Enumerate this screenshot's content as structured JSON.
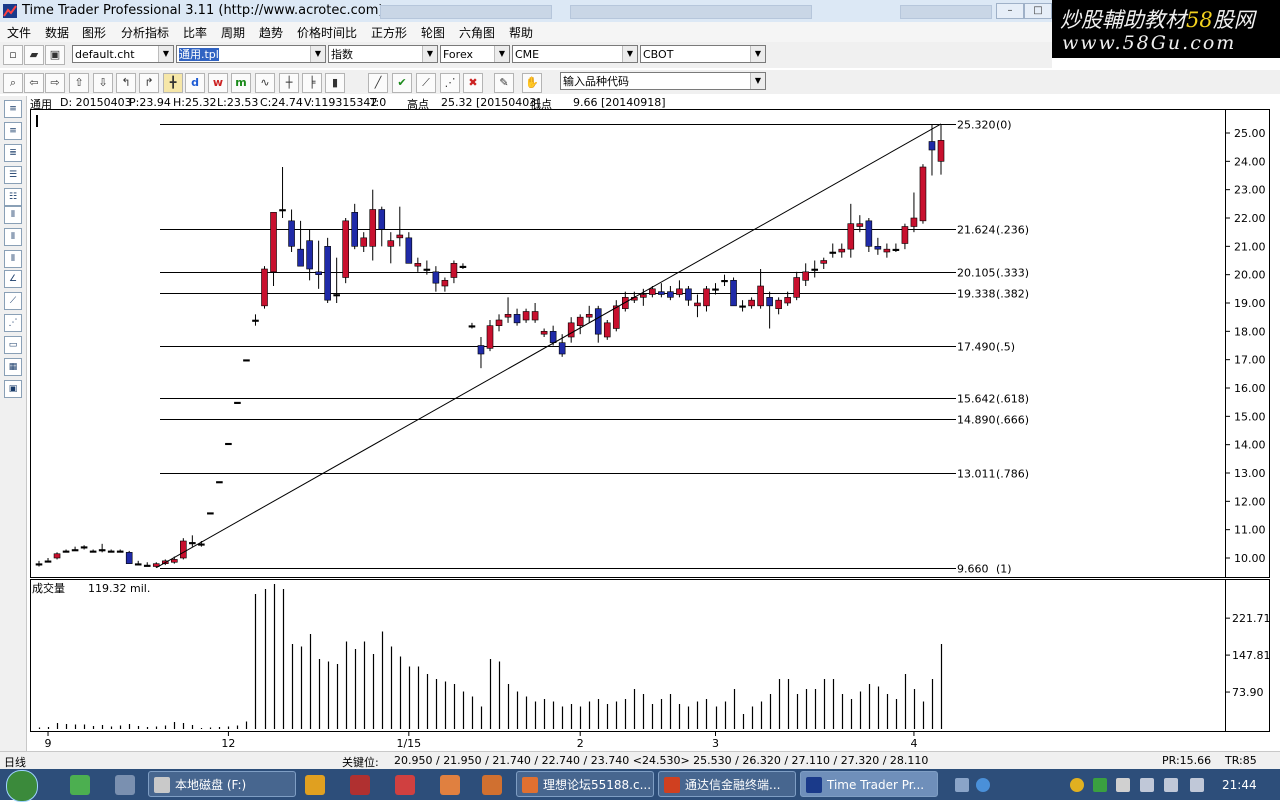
{
  "window": {
    "app_name": "Time Trader Professional 3.11",
    "url": "(http://www.acrotec.com)"
  },
  "watermark": {
    "line1_prefix": "炒股輔助教材",
    "line1_num": "58",
    "line1_suffix": "股网",
    "line2": "www.58Gu.com"
  },
  "menu": [
    "文件",
    "数据",
    "图形",
    "分析指标",
    "比率",
    "周期",
    "趋势",
    "价格时间比",
    "正方形",
    "轮图",
    "六角图",
    "帮助"
  ],
  "toolbar": {
    "chart_file": "default.cht",
    "template": "通用.tpl",
    "index": "指数",
    "market1": "Forex",
    "market2": "CME",
    "market3": "CBOT",
    "symbol_input": "输入品种代码"
  },
  "info": {
    "name": "通用",
    "date": "D: 20150403",
    "p": "P:23.94",
    "h": "H:25.32",
    "l": "L:23.53",
    "c": "C:24.74",
    "v": "V:119315342",
    "t": "T:0",
    "high_label": "高点",
    "high_value": "25.32 [20150403]",
    "low_label": "低点",
    "low_value": "9.66 [20140918]"
  },
  "volume": {
    "label": "成交量",
    "value": "119.32 mil."
  },
  "status": {
    "period": "日线",
    "key_label": "关键位:",
    "key_values": "20.950 / 21.950 / 21.740 / 22.740 / 23.740 <24.530> 25.530 / 26.320 / 27.110 / 27.320 / 28.110",
    "pr": "PR:15.66",
    "tr": "TR:85"
  },
  "taskbar": {
    "tasks": [
      "本地磁盘 (F:)",
      "理想论坛55188.c...",
      "通达信金融终端...",
      "Time Trader Pr..."
    ],
    "clock": "21:44"
  },
  "chart_data": {
    "type": "candlestick",
    "price_axis": {
      "ylim": [
        9.5,
        25.4
      ],
      "ticks": [
        "25.00",
        "24.00",
        "23.00",
        "22.00",
        "21.00",
        "20.00",
        "19.00",
        "18.00",
        "17.00",
        "16.00",
        "15.00",
        "14.00",
        "13.00",
        "12.00",
        "11.00",
        "10.00"
      ]
    },
    "x_tick_labels": [
      "9",
      "12",
      "1/15",
      "2",
      "3",
      "4"
    ],
    "fib_levels": [
      {
        "price": 25.32,
        "label": "25.320",
        "ratio": "(0)"
      },
      {
        "price": 21.624,
        "label": "21.624",
        "ratio": "(.236)"
      },
      {
        "price": 20.105,
        "label": "20.105",
        "ratio": "(.333)"
      },
      {
        "price": 19.338,
        "label": "19.338",
        "ratio": "(.382)"
      },
      {
        "price": 17.49,
        "label": "17.490",
        "ratio": "(.5)"
      },
      {
        "price": 15.642,
        "label": "15.642",
        "ratio": "(.618)"
      },
      {
        "price": 14.89,
        "label": "14.890",
        "ratio": "(.666)"
      },
      {
        "price": 13.011,
        "label": "13.011",
        "ratio": "(.786)"
      },
      {
        "price": 9.66,
        "label": "9.660",
        "ratio": "(1)"
      }
    ],
    "trendline": {
      "from_bar": 13,
      "from_price": 9.66,
      "to_bar": 100,
      "to_price": 25.32
    },
    "volume_axis": {
      "ticks": [
        "221.71",
        "147.81",
        "73.90"
      ],
      "ylim": [
        0,
        290
      ]
    },
    "candles": [
      {
        "o": 9.8,
        "h": 9.9,
        "l": 9.7,
        "c": 9.8
      },
      {
        "o": 9.9,
        "h": 10.0,
        "l": 9.85,
        "c": 9.9
      },
      {
        "o": 10.0,
        "h": 10.2,
        "l": 9.95,
        "c": 10.15
      },
      {
        "o": 10.25,
        "h": 10.3,
        "l": 10.2,
        "c": 10.25
      },
      {
        "o": 10.3,
        "h": 10.4,
        "l": 10.25,
        "c": 10.3
      },
      {
        "o": 10.4,
        "h": 10.45,
        "l": 10.3,
        "c": 10.35
      },
      {
        "o": 10.25,
        "h": 10.3,
        "l": 10.2,
        "c": 10.25
      },
      {
        "o": 10.3,
        "h": 10.5,
        "l": 10.2,
        "c": 10.3
      },
      {
        "o": 10.25,
        "h": 10.3,
        "l": 10.2,
        "c": 10.25
      },
      {
        "o": 10.25,
        "h": 10.3,
        "l": 10.2,
        "c": 10.25
      },
      {
        "o": 10.2,
        "h": 10.25,
        "l": 9.8,
        "c": 9.8
      },
      {
        "o": 9.8,
        "h": 9.9,
        "l": 9.75,
        "c": 9.8
      },
      {
        "o": 9.75,
        "h": 9.85,
        "l": 9.7,
        "c": 9.7
      },
      {
        "o": 9.7,
        "h": 9.85,
        "l": 9.66,
        "c": 9.8
      },
      {
        "o": 9.8,
        "h": 9.95,
        "l": 9.75,
        "c": 9.9
      },
      {
        "o": 9.85,
        "h": 10.05,
        "l": 9.8,
        "c": 9.95
      },
      {
        "o": 10.0,
        "h": 10.7,
        "l": 9.95,
        "c": 10.6
      },
      {
        "o": 10.5,
        "h": 10.8,
        "l": 10.4,
        "c": 10.55
      },
      {
        "o": 10.5,
        "h": 10.6,
        "l": 10.4,
        "c": 10.5
      },
      {
        "o": 11.6,
        "h": 11.6,
        "l": 11.6,
        "c": 11.6
      },
      {
        "o": 12.7,
        "h": 12.7,
        "l": 12.7,
        "c": 12.7
      },
      {
        "o": 14.05,
        "h": 14.05,
        "l": 14.05,
        "c": 14.05
      },
      {
        "o": 15.5,
        "h": 15.5,
        "l": 15.5,
        "c": 15.5
      },
      {
        "o": 17.0,
        "h": 17.0,
        "l": 17.0,
        "c": 17.0
      },
      {
        "o": 18.4,
        "h": 18.6,
        "l": 18.2,
        "c": 18.4
      },
      {
        "o": 18.9,
        "h": 20.3,
        "l": 18.8,
        "c": 20.2
      },
      {
        "o": 20.1,
        "h": 22.2,
        "l": 19.6,
        "c": 22.2
      },
      {
        "o": 22.3,
        "h": 23.8,
        "l": 22.0,
        "c": 22.3
      },
      {
        "o": 21.9,
        "h": 22.3,
        "l": 20.8,
        "c": 21.0
      },
      {
        "o": 20.9,
        "h": 21.9,
        "l": 20.5,
        "c": 20.3
      },
      {
        "o": 21.2,
        "h": 21.6,
        "l": 19.8,
        "c": 20.2
      },
      {
        "o": 20.1,
        "h": 21.2,
        "l": 19.5,
        "c": 20.0
      },
      {
        "o": 21.0,
        "h": 21.3,
        "l": 19.0,
        "c": 19.1
      },
      {
        "o": 19.3,
        "h": 20.6,
        "l": 19.0,
        "c": 19.3
      },
      {
        "o": 19.9,
        "h": 22.0,
        "l": 19.7,
        "c": 21.9
      },
      {
        "o": 22.2,
        "h": 22.5,
        "l": 20.9,
        "c": 21.0
      },
      {
        "o": 21.0,
        "h": 21.5,
        "l": 20.8,
        "c": 21.3
      },
      {
        "o": 21.0,
        "h": 23.0,
        "l": 20.5,
        "c": 22.3
      },
      {
        "o": 22.3,
        "h": 22.4,
        "l": 21.0,
        "c": 21.6
      },
      {
        "o": 21.0,
        "h": 21.5,
        "l": 20.4,
        "c": 21.2
      },
      {
        "o": 21.3,
        "h": 22.4,
        "l": 21.0,
        "c": 21.4
      },
      {
        "o": 21.3,
        "h": 21.5,
        "l": 20.4,
        "c": 20.4
      },
      {
        "o": 20.3,
        "h": 20.6,
        "l": 20.1,
        "c": 20.4
      },
      {
        "o": 20.2,
        "h": 20.5,
        "l": 20.0,
        "c": 20.2
      },
      {
        "o": 20.1,
        "h": 20.3,
        "l": 19.4,
        "c": 19.7
      },
      {
        "o": 19.6,
        "h": 19.9,
        "l": 19.4,
        "c": 19.8
      },
      {
        "o": 19.9,
        "h": 20.5,
        "l": 19.7,
        "c": 20.4
      },
      {
        "o": 20.3,
        "h": 20.4,
        "l": 20.2,
        "c": 20.3
      },
      {
        "o": 18.2,
        "h": 18.3,
        "l": 18.1,
        "c": 18.2
      },
      {
        "o": 17.5,
        "h": 17.8,
        "l": 16.7,
        "c": 17.2
      },
      {
        "o": 17.4,
        "h": 18.4,
        "l": 17.3,
        "c": 18.2
      },
      {
        "o": 18.2,
        "h": 18.6,
        "l": 18.0,
        "c": 18.4
      },
      {
        "o": 18.5,
        "h": 19.2,
        "l": 18.3,
        "c": 18.6
      },
      {
        "o": 18.6,
        "h": 18.8,
        "l": 18.2,
        "c": 18.3
      },
      {
        "o": 18.4,
        "h": 18.8,
        "l": 18.3,
        "c": 18.7
      },
      {
        "o": 18.4,
        "h": 19.0,
        "l": 18.3,
        "c": 18.7
      },
      {
        "o": 17.9,
        "h": 18.1,
        "l": 17.8,
        "c": 18.0
      },
      {
        "o": 18.0,
        "h": 18.2,
        "l": 17.5,
        "c": 17.6
      },
      {
        "o": 17.6,
        "h": 17.9,
        "l": 17.1,
        "c": 17.2
      },
      {
        "o": 17.8,
        "h": 18.5,
        "l": 17.6,
        "c": 18.3
      },
      {
        "o": 18.2,
        "h": 18.6,
        "l": 17.9,
        "c": 18.5
      },
      {
        "o": 18.5,
        "h": 18.9,
        "l": 18.3,
        "c": 18.6
      },
      {
        "o": 18.8,
        "h": 18.9,
        "l": 17.6,
        "c": 17.9
      },
      {
        "o": 17.8,
        "h": 18.4,
        "l": 17.7,
        "c": 18.3
      },
      {
        "o": 18.1,
        "h": 19.1,
        "l": 18.0,
        "c": 18.9
      },
      {
        "o": 18.8,
        "h": 19.4,
        "l": 18.7,
        "c": 19.2
      },
      {
        "o": 19.1,
        "h": 19.4,
        "l": 19.0,
        "c": 19.2
      },
      {
        "o": 19.2,
        "h": 19.5,
        "l": 18.9,
        "c": 19.3
      },
      {
        "o": 19.3,
        "h": 19.6,
        "l": 19.2,
        "c": 19.5
      },
      {
        "o": 19.4,
        "h": 19.7,
        "l": 19.2,
        "c": 19.3
      },
      {
        "o": 19.4,
        "h": 19.6,
        "l": 19.1,
        "c": 19.2
      },
      {
        "o": 19.3,
        "h": 19.8,
        "l": 19.2,
        "c": 19.5
      },
      {
        "o": 19.5,
        "h": 19.6,
        "l": 18.9,
        "c": 19.1
      },
      {
        "o": 18.9,
        "h": 19.3,
        "l": 18.5,
        "c": 19.0
      },
      {
        "o": 18.9,
        "h": 19.6,
        "l": 18.7,
        "c": 19.5
      },
      {
        "o": 19.5,
        "h": 19.7,
        "l": 19.3,
        "c": 19.5
      },
      {
        "o": 19.8,
        "h": 20.0,
        "l": 19.6,
        "c": 19.8
      },
      {
        "o": 19.8,
        "h": 19.9,
        "l": 18.9,
        "c": 18.9
      },
      {
        "o": 18.9,
        "h": 19.1,
        "l": 18.7,
        "c": 18.9
      },
      {
        "o": 18.9,
        "h": 19.2,
        "l": 18.8,
        "c": 19.1
      },
      {
        "o": 18.9,
        "h": 20.2,
        "l": 18.8,
        "c": 19.6
      },
      {
        "o": 19.2,
        "h": 19.4,
        "l": 18.1,
        "c": 18.9
      },
      {
        "o": 18.8,
        "h": 19.2,
        "l": 18.6,
        "c": 19.1
      },
      {
        "o": 19.0,
        "h": 19.4,
        "l": 18.9,
        "c": 19.2
      },
      {
        "o": 19.2,
        "h": 20.1,
        "l": 19.1,
        "c": 19.9
      },
      {
        "o": 19.8,
        "h": 20.4,
        "l": 19.6,
        "c": 20.1
      },
      {
        "o": 20.2,
        "h": 20.5,
        "l": 19.9,
        "c": 20.2
      },
      {
        "o": 20.4,
        "h": 20.6,
        "l": 20.2,
        "c": 20.5
      },
      {
        "o": 20.8,
        "h": 21.1,
        "l": 20.6,
        "c": 20.8
      },
      {
        "o": 20.8,
        "h": 21.1,
        "l": 20.6,
        "c": 20.9
      },
      {
        "o": 20.9,
        "h": 22.5,
        "l": 20.6,
        "c": 21.8
      },
      {
        "o": 21.7,
        "h": 22.1,
        "l": 21.5,
        "c": 21.8
      },
      {
        "o": 21.9,
        "h": 22.0,
        "l": 20.8,
        "c": 21.0
      },
      {
        "o": 21.0,
        "h": 21.3,
        "l": 20.7,
        "c": 20.9
      },
      {
        "o": 20.8,
        "h": 21.1,
        "l": 20.6,
        "c": 20.9
      },
      {
        "o": 20.9,
        "h": 21.1,
        "l": 20.8,
        "c": 20.9
      },
      {
        "o": 21.1,
        "h": 21.8,
        "l": 20.9,
        "c": 21.7
      },
      {
        "o": 21.7,
        "h": 22.9,
        "l": 21.5,
        "c": 22.0
      },
      {
        "o": 21.9,
        "h": 23.9,
        "l": 21.8,
        "c": 23.8
      },
      {
        "o": 24.7,
        "h": 25.3,
        "l": 23.5,
        "c": 24.4
      },
      {
        "o": 24.0,
        "h": 25.32,
        "l": 23.53,
        "c": 24.74
      }
    ],
    "volumes": [
      3,
      4,
      12,
      10,
      9,
      9,
      6,
      8,
      5,
      7,
      10,
      6,
      4,
      5,
      7,
      14,
      12,
      8,
      2,
      3,
      4,
      5,
      7,
      15,
      270,
      280,
      290,
      280,
      170,
      165,
      190,
      140,
      135,
      130,
      175,
      160,
      175,
      150,
      195,
      165,
      145,
      125,
      125,
      110,
      100,
      95,
      90,
      75,
      65,
      45,
      140,
      135,
      90,
      75,
      65,
      55,
      60,
      55,
      45,
      50,
      45,
      55,
      60,
      50,
      55,
      60,
      80,
      70,
      50,
      60,
      70,
      50,
      45,
      55,
      60,
      45,
      55,
      80,
      30,
      45,
      55,
      70,
      100,
      100,
      70,
      80,
      80,
      100,
      100,
      70,
      60,
      75,
      90,
      85,
      70,
      60,
      110,
      80,
      55,
      100,
      170,
      110,
      90,
      100,
      210,
      210,
      185
    ]
  }
}
